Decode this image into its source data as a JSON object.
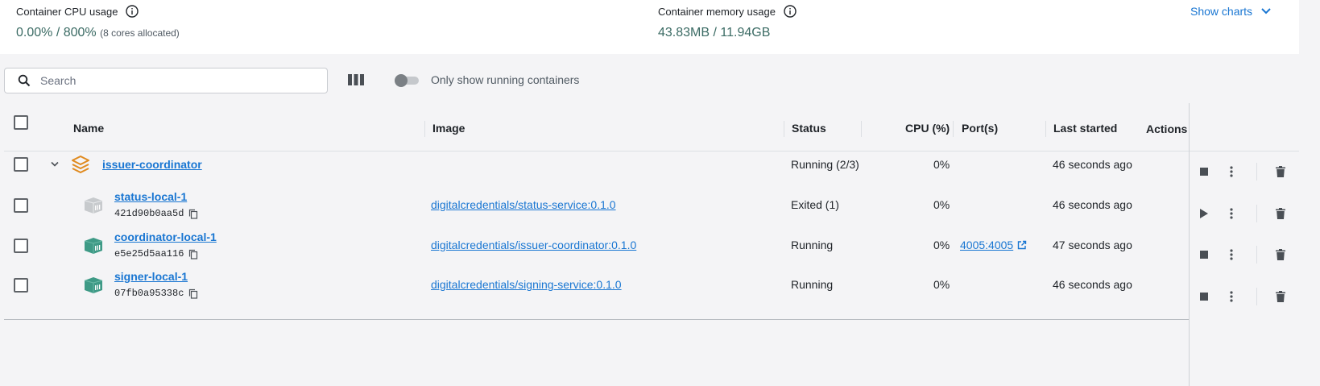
{
  "stats": {
    "cpu_label": "Container CPU usage",
    "cpu_value": "0.00%",
    "cpu_sep": " / ",
    "cpu_total": "800%",
    "cpu_note": "(8 cores allocated)",
    "mem_label": "Container memory usage",
    "mem_value": "43.83MB",
    "mem_sep": " / ",
    "mem_total": "11.94GB",
    "show_charts": "Show charts"
  },
  "toolbar": {
    "search_placeholder": "Search",
    "toggle_label": "Only show running containers",
    "toggle_on": false
  },
  "table": {
    "headers": {
      "name": "Name",
      "image": "Image",
      "status": "Status",
      "cpu": "CPU (%)",
      "ports": "Port(s)",
      "last_started": "Last started",
      "actions": "Actions"
    },
    "group": {
      "name": "issuer-coordinator",
      "status": "Running (2/3)",
      "cpu": "0%",
      "last_started": "46 seconds ago"
    },
    "rows": [
      {
        "name": "status-local-1",
        "id": "421d90b0aa5d",
        "image": "digitalcredentials/status-service:0.1.0",
        "status": "Exited (1)",
        "cpu": "0%",
        "port": "",
        "last_started": "46 seconds ago",
        "running": false
      },
      {
        "name": "coordinator-local-1",
        "id": "e5e25d5aa116",
        "image": "digitalcredentials/issuer-coordinator:0.1.0",
        "status": "Running",
        "cpu": "0%",
        "port": "4005:4005",
        "last_started": "47 seconds ago",
        "running": true
      },
      {
        "name": "signer-local-1",
        "id": "07fb0a95338c",
        "image": "digitalcredentials/signing-service:0.1.0",
        "status": "Running",
        "cpu": "0%",
        "port": "",
        "last_started": "46 seconds ago",
        "running": true
      }
    ]
  },
  "colors": {
    "accent": "#1976d2",
    "stat_value": "#3b6b64",
    "container_running": "#3e9a86",
    "container_exited": "#c7cacd",
    "group_icon": "#e08a1e"
  }
}
